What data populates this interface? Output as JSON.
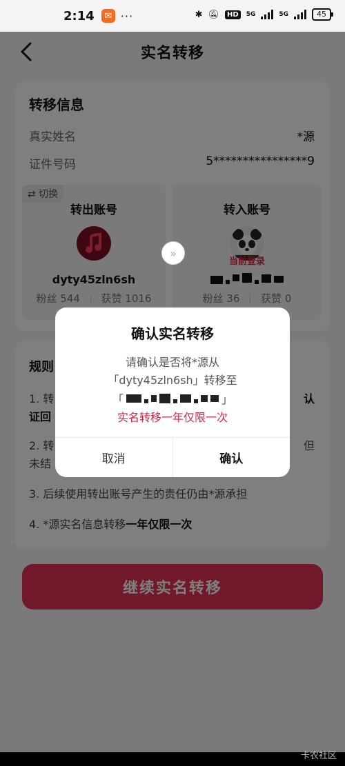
{
  "status_bar": {
    "time": "2:14",
    "dots": "···",
    "hd": "HD",
    "network1": "5G",
    "network2": "5G",
    "battery": "45"
  },
  "nav": {
    "title": "实名转移"
  },
  "info": {
    "title": "转移信息",
    "real_name_label": "真实姓名",
    "real_name_value": "*源",
    "id_label": "证件号码",
    "id_value": "5****************9"
  },
  "out_account": {
    "switch": "⇄ 切换",
    "title": "转出账号",
    "name": "dyty45zln6sh",
    "fans_label": "粉丝",
    "fans": "544",
    "likes_label": "获赞",
    "likes": "1016"
  },
  "in_account": {
    "title": "转入账号",
    "current": "当前登录",
    "fans_label": "粉丝",
    "fans": "36",
    "likes_label": "获赞",
    "likes": "0"
  },
  "rules": {
    "title": "规则",
    "r1a": "1. 转",
    "r1b": "认",
    "r1c": "证回",
    "r2a": "2. 转",
    "r2b": "但",
    "r2c": "未结",
    "r3": "3. 后续使用转出账号产生的责任仍由*源承担",
    "r4_prefix": "4. *源实名信息转移",
    "r4_bold": "一年仅限一次"
  },
  "cta": "继续实名转移",
  "dialog": {
    "title": "确认实名转移",
    "line1": "请确认是否将*源从",
    "line2": "「dyty45zln6sh」转移至",
    "bracket_open": "「",
    "bracket_close": "」",
    "warning": "实名转移一年仅限一次",
    "cancel": "取消",
    "confirm": "确认"
  },
  "watermark": "卡农社区"
}
